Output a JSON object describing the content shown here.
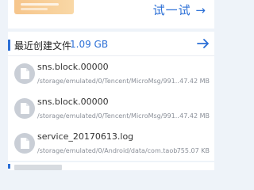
{
  "top": {
    "try_link": "试一试 →"
  },
  "recent": {
    "title": "最近创建文件",
    "total_size": "1.09 GB",
    "icons": {
      "arrow": "arrow-right-icon",
      "file": "file-icon"
    },
    "accent_color": "#2b6fd6",
    "files": [
      {
        "name": "sns.block.00000",
        "path": "/storage/emulated/0/Tencent/MicroMsg/991...",
        "size": "47.42 MB"
      },
      {
        "name": "sns.block.00000",
        "path": "/storage/emulated/0/Tencent/MicroMsg/991...",
        "size": "47.42 MB"
      },
      {
        "name": "service_20170613.log",
        "path": "/storage/emulated/0/Android/data/com.taob...",
        "size": "755.07 KB"
      }
    ]
  }
}
